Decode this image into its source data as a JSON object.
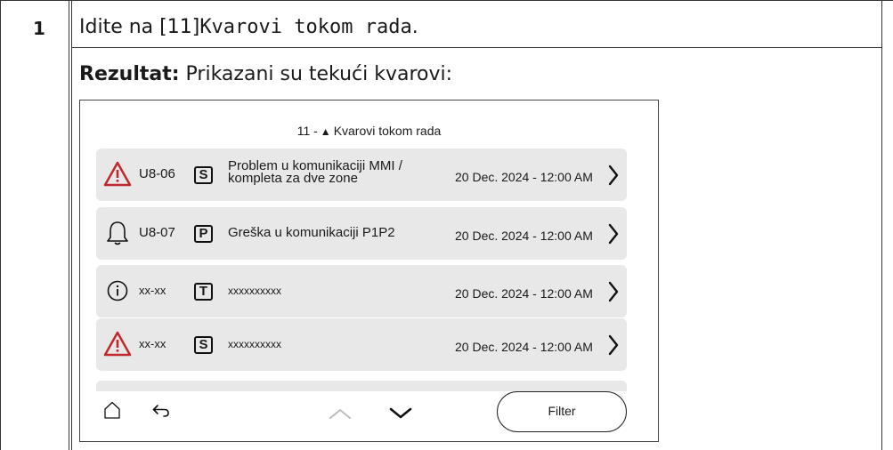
{
  "step": {
    "number": "1",
    "prefix": "Idite na [11]",
    "menu_name": "Kvarovi tokom rada",
    "suffix": "."
  },
  "result": {
    "label": "Rezultat:",
    "text": " Prikazani su tekući kvarovi:"
  },
  "screen": {
    "title_prefix": "11 -",
    "title_icon": "warning-triangle-icon",
    "title": "Kvarovi tokom rada",
    "rows": [
      {
        "icon": "warning-triangle-icon",
        "code": "U8-06",
        "type": "S",
        "desc_line1": "Problem u komunikaciji MMI /",
        "desc_line2": "kompleta za dve zone",
        "date": "20 Dec. 2024 - 12:00 AM"
      },
      {
        "icon": "bell-icon",
        "code": "U8-07",
        "type": "P",
        "desc": "Greška u komunikaciji P1P2",
        "date": "20 Dec. 2024 - 12:00 AM"
      },
      {
        "icon": "info-circle-icon",
        "code": "xx-xx",
        "type": "T",
        "desc": "xxxxxxxxxx",
        "date": "20 Dec. 2024 - 12:00 AM"
      },
      {
        "icon": "warning-triangle-icon",
        "code": "xx-xx",
        "type": "S",
        "desc": "xxxxxxxxxx",
        "date": "20 Dec. 2024 - 12:00 AM"
      }
    ],
    "filter_label": "Filter"
  },
  "colors": {
    "warning_red": "#c0282d",
    "row_bg": "#e7e8e7",
    "scroll_up_disabled": "#bbbbbb"
  }
}
